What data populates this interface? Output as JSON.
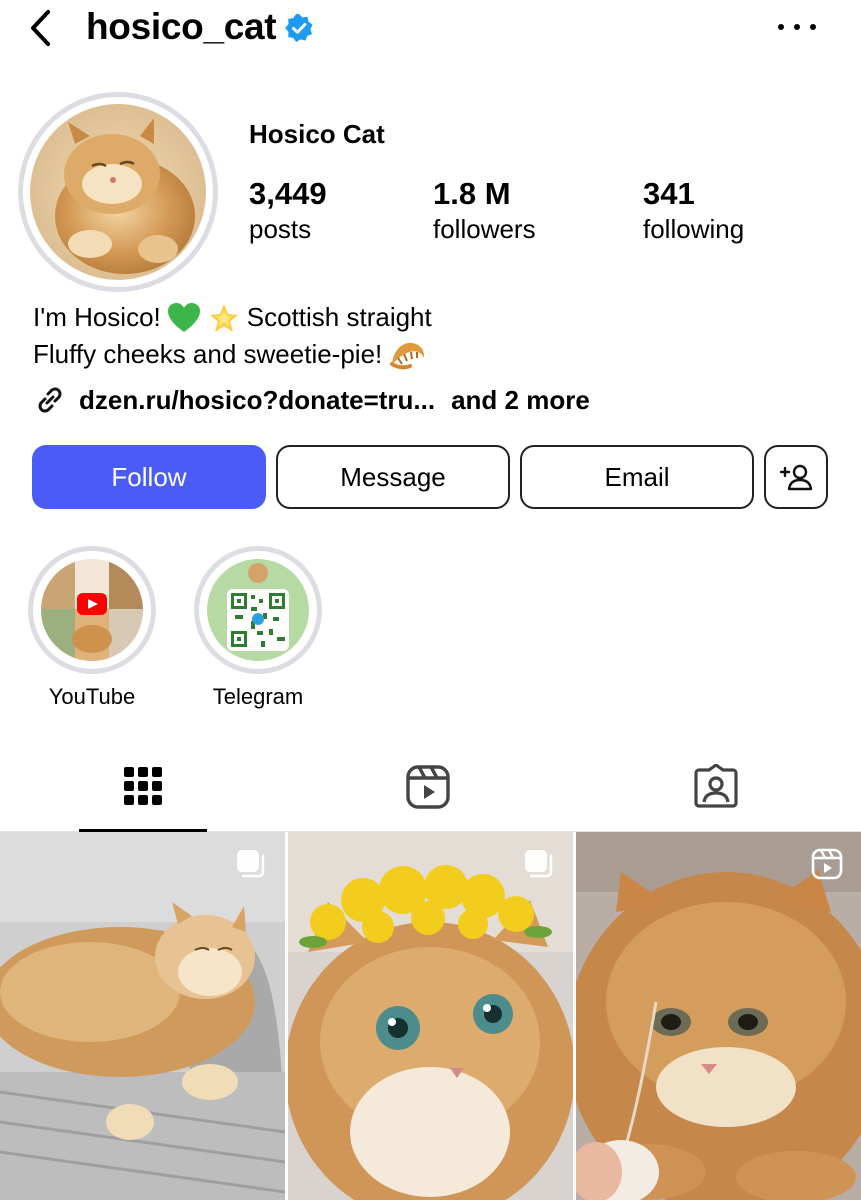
{
  "header": {
    "username": "hosico_cat",
    "back_icon": "chevron-left-icon",
    "verified_icon": "verified-badge-icon",
    "more_icon": "more-horizontal-icon"
  },
  "profile": {
    "display_name": "Hosico Cat",
    "stats": [
      {
        "value": "3,449",
        "label": "posts"
      },
      {
        "value": "1.8 M",
        "label": "followers"
      },
      {
        "value": "341",
        "label": "following"
      }
    ],
    "bio_line1_a": "I'm Hosico!",
    "bio_line1_b": "Scottish straight",
    "bio_line2": "Fluffy cheeks and sweetie-pie!",
    "bio_emojis": [
      "green-heart",
      "glowing-star",
      "croissant"
    ],
    "link_text": "dzen.ru/hosico?donate=tru...",
    "link_more": "and 2 more"
  },
  "actions": {
    "follow": "Follow",
    "message": "Message",
    "email": "Email",
    "add_user_icon": "add-user-icon"
  },
  "highlights": [
    {
      "label": "YouTube"
    },
    {
      "label": "Telegram"
    }
  ],
  "tabs": [
    {
      "icon": "grid-icon",
      "active": true
    },
    {
      "icon": "reels-icon",
      "active": false
    },
    {
      "icon": "tagged-icon",
      "active": false
    }
  ],
  "posts": [
    {
      "badge": "carousel-icon"
    },
    {
      "badge": "carousel-icon"
    },
    {
      "badge": "reel-icon"
    }
  ],
  "colors": {
    "follow_button": "#4a5cf5",
    "verified": "#1d9bf0",
    "ring": "#dbdde3"
  }
}
